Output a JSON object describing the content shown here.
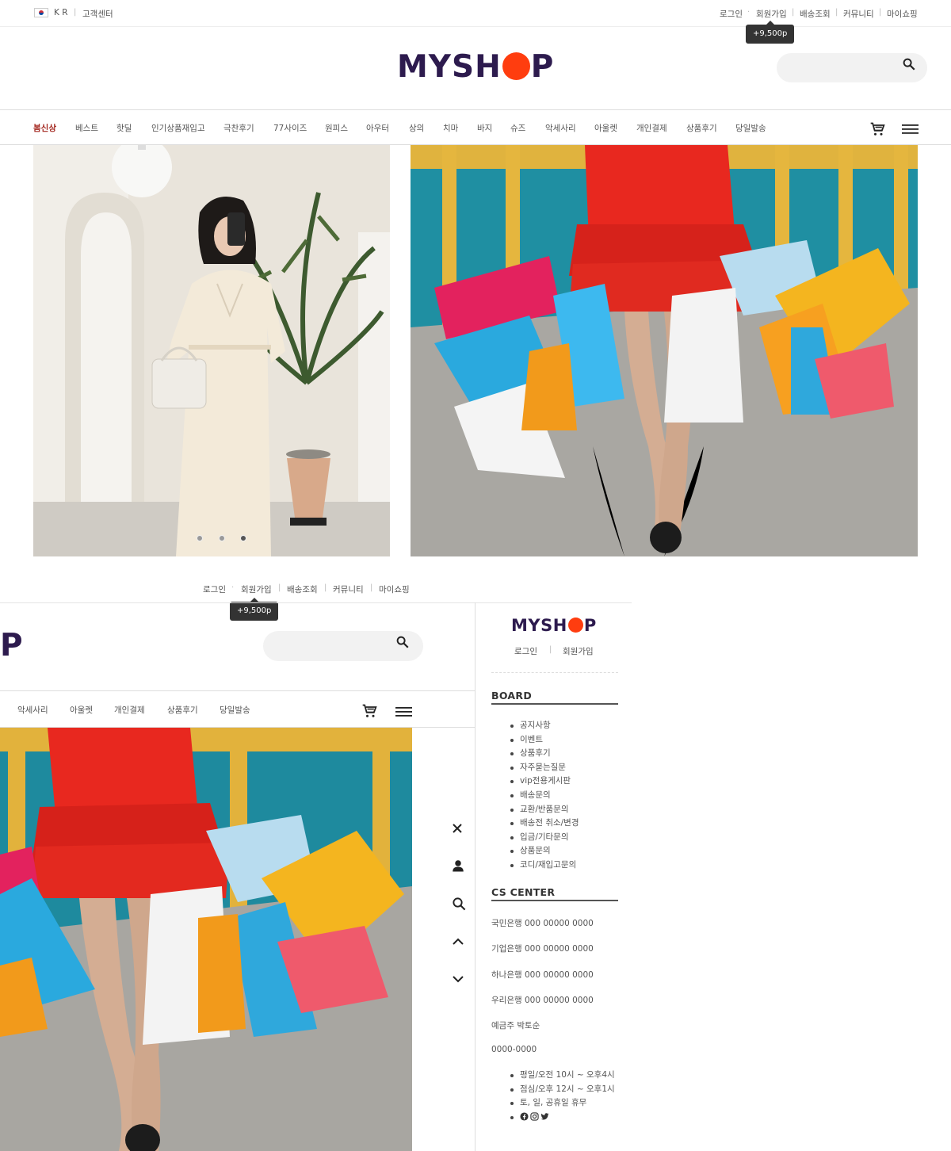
{
  "topbar": {
    "country": "K R",
    "customer_center": "고객센터",
    "links": [
      "로그인",
      "회원가입",
      "배송조회",
      "커뮤니티",
      "마이쇼핑"
    ],
    "points_tooltip": "+9,500p"
  },
  "logo": {
    "left": "MYSH",
    "right": "P"
  },
  "search": {
    "placeholder": ""
  },
  "nav": {
    "items": [
      "봄신상",
      "베스트",
      "핫딜",
      "인기상품재입고",
      "극찬후기",
      "77사이즈",
      "원피스",
      "아우터",
      "상의",
      "치마",
      "바지",
      "슈즈",
      "악세사리",
      "아울렛",
      "개인결제",
      "상품후기",
      "당일발송"
    ],
    "active_index": 0
  },
  "slider": {
    "count": 3,
    "active_index": 2
  },
  "overlay": {
    "links": [
      "로그인",
      "회원가입",
      "배송조회",
      "커뮤니티",
      "마이쇼핑"
    ],
    "points_tooltip": "+9,500p",
    "logo_partial": "P",
    "nav_items": [
      "악세사리",
      "아울렛",
      "개인결제",
      "상품후기",
      "당일발송"
    ]
  },
  "side_menu": {
    "logo": {
      "left": "MYSH",
      "right": "P"
    },
    "login": "로그인",
    "join": "회원가입",
    "board_title": "BOARD",
    "board_items": [
      "공지사항",
      "이벤트",
      "상품후기",
      "자주묻는질문",
      "vip전용게시판",
      "배송문의",
      "교환/반품문의",
      "배송전 취소/변경",
      "입금/기타문의",
      "상품문의",
      "코디/재입고문의"
    ],
    "cs_title": "CS CENTER",
    "banks": [
      "국민은행 000 00000 0000",
      "기업은행 000 00000 0000",
      "하나은행 000 00000 0000",
      "우리은행 000 00000 0000"
    ],
    "holder": "예금주 박토순",
    "phone": "0000-0000",
    "hours": [
      "평일/오전 10시 ~ 오후4시",
      "점심/오후 12시 ~ 오후1시",
      "토, 일, 공휴일 휴무"
    ],
    "social_icons": [
      "facebook-icon",
      "instagram-icon",
      "twitter-icon"
    ]
  },
  "quick_icons": [
    "close-icon",
    "user-icon",
    "search-icon",
    "chevron-up-icon",
    "chevron-down-icon"
  ],
  "colors": {
    "brand": "#2d1b4e",
    "accent": "#ff3d0f",
    "active_nav": "#a3271f"
  }
}
